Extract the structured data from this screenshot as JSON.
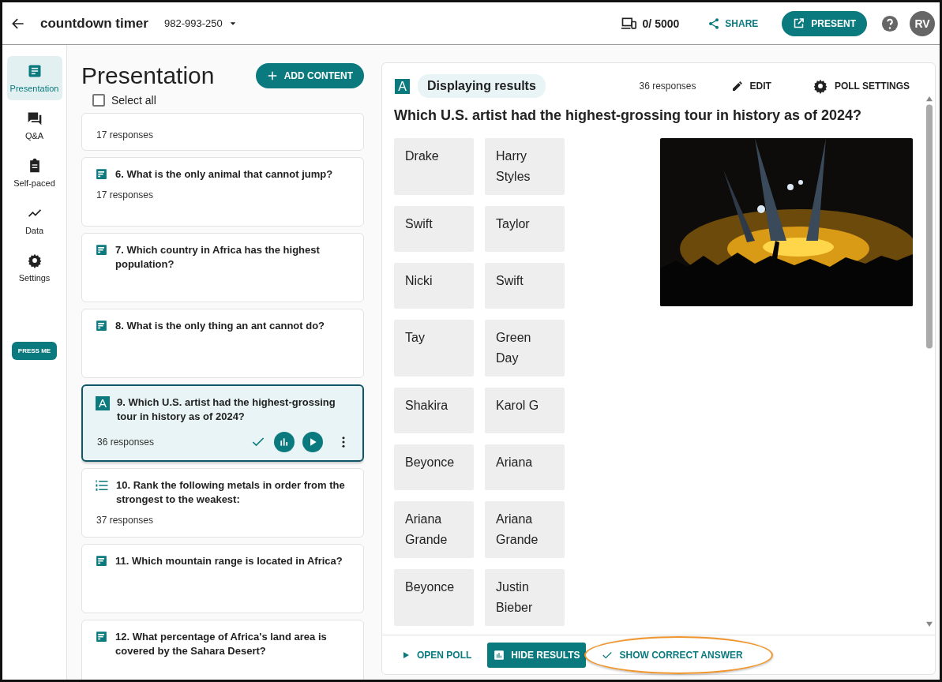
{
  "header": {
    "title": "countdown timer",
    "code": "982-993-250",
    "devices": "0/ 5000",
    "share": "SHARE",
    "present": "PRESENT",
    "avatar": "RV"
  },
  "nav": [
    {
      "label": "Presentation",
      "selected": true
    },
    {
      "label": "Q&A",
      "selected": false
    },
    {
      "label": "Self-paced",
      "selected": false
    },
    {
      "label": "Data",
      "selected": false
    },
    {
      "label": "Settings",
      "selected": false
    }
  ],
  "press_me": "PRESS ME",
  "list": {
    "heading": "Presentation",
    "add": "ADD CONTENT",
    "select_all": {
      "label": "Select all",
      "checked": false
    },
    "cards": [
      {
        "kind": "cut",
        "responses": "17 responses",
        "selected": false
      },
      {
        "kind": "text",
        "title": "6. What is the only animal that cannot jump?",
        "responses": "17 responses",
        "selected": false
      },
      {
        "kind": "text",
        "title": "7. Which country in Africa has the highest population?",
        "selected": false
      },
      {
        "kind": "text",
        "title": "8. What is the only thing an ant cannot do?",
        "selected": false
      },
      {
        "kind": "choice",
        "glyph": "A",
        "title": "9. Which U.S. artist had the highest-grossing tour in history as of 2024?",
        "responses": "36 responses",
        "selected": true
      },
      {
        "kind": "rank",
        "title": "10. Rank the following metals in order from the strongest to the weakest:",
        "responses": "37 responses",
        "selected": false
      },
      {
        "kind": "text",
        "title": "11. Which mountain range is located in Africa?",
        "selected": false
      },
      {
        "kind": "text",
        "title": "12. What percentage of Africa's land area is covered by the Sahara Desert?",
        "selected": false
      }
    ]
  },
  "poll": {
    "glyph": "A",
    "status": "Displaying results",
    "responses": "36 responses",
    "edit": "EDIT",
    "settings": "POLL SETTINGS",
    "question": "Which U.S. artist had the highest-grossing tour in history as of 2024?",
    "answers": [
      [
        "Drake",
        "Harry Styles"
      ],
      [
        "Swift",
        "Taylor"
      ],
      [
        "Nicki",
        "Swift"
      ],
      [
        "Tay",
        "Green Day"
      ],
      [
        "Shakira",
        "Karol G"
      ],
      [
        "Beyonce",
        "Ariana"
      ],
      [
        "Ariana Grande",
        "Ariana Grande"
      ],
      [
        "Beyonce",
        "Justin Bieber"
      ]
    ],
    "footer": [
      {
        "label": "OPEN POLL",
        "kind": "text",
        "highlighted": false
      },
      {
        "label": "HIDE RESULTS",
        "kind": "filled",
        "highlighted": false
      },
      {
        "label": "SHOW CORRECT ANSWER",
        "kind": "text",
        "highlighted": true
      }
    ]
  }
}
